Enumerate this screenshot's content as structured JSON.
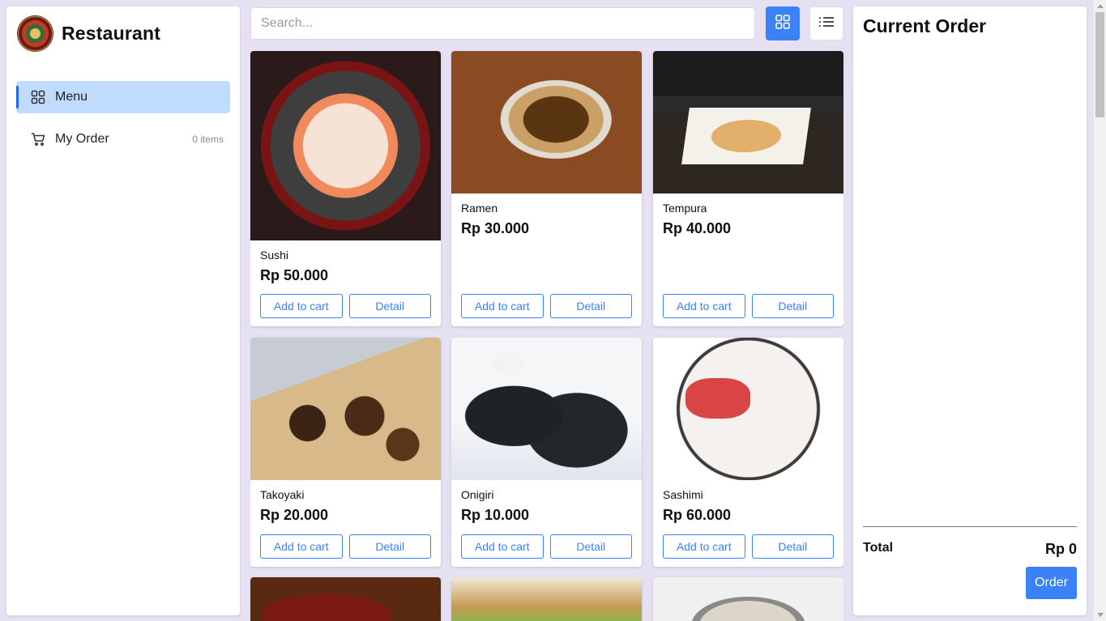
{
  "brand": {
    "name": "Restaurant",
    "logo_icon": "restaurant-logo-icon"
  },
  "nav": {
    "items": [
      {
        "label": "Menu",
        "icon": "grid-icon",
        "active": true
      },
      {
        "label": "My Order",
        "icon": "cart-icon",
        "count": "0 items"
      }
    ]
  },
  "search": {
    "placeholder": "Search...",
    "value": ""
  },
  "view_toggle": {
    "grid_icon": "grid-view-icon",
    "list_icon": "list-view-icon",
    "active": "grid"
  },
  "menu_items": [
    {
      "name": "Sushi",
      "price": "Rp 50.000",
      "add_label": "Add to cart",
      "detail_label": "Detail"
    },
    {
      "name": "Ramen",
      "price": "Rp 30.000",
      "add_label": "Add to cart",
      "detail_label": "Detail"
    },
    {
      "name": "Tempura",
      "price": "Rp 40.000",
      "add_label": "Add to cart",
      "detail_label": "Detail"
    },
    {
      "name": "Takoyaki",
      "price": "Rp 20.000",
      "add_label": "Add to cart",
      "detail_label": "Detail"
    },
    {
      "name": "Onigiri",
      "price": "Rp 10.000",
      "add_label": "Add to cart",
      "detail_label": "Detail"
    },
    {
      "name": "Sashimi",
      "price": "Rp 60.000",
      "add_label": "Add to cart",
      "detail_label": "Detail"
    }
  ],
  "order": {
    "title": "Current Order",
    "total_label": "Total",
    "total_value": "Rp 0",
    "order_label": "Order"
  },
  "colors": {
    "accent": "#3b82f6",
    "active_nav_bg": "#bfdbfe",
    "page_bg": "#e6e1f2"
  }
}
